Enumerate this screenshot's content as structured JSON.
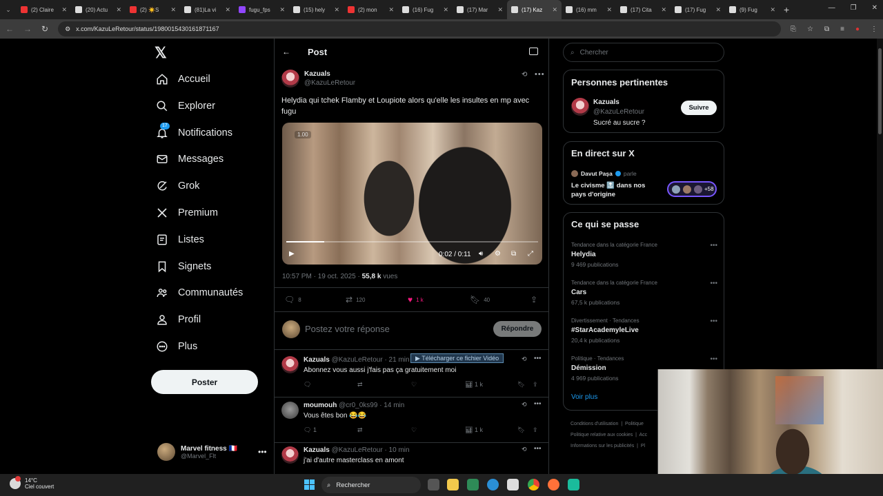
{
  "browser": {
    "tabs": [
      {
        "label": "(2) Claire",
        "color": "#e33"
      },
      {
        "label": "(20) Actu",
        "color": "#ddd"
      },
      {
        "label": "(2) ☀️S",
        "color": "#e33"
      },
      {
        "label": "(81)La vi",
        "color": "#ddd"
      },
      {
        "label": "fugu_fps",
        "color": "#9146ff"
      },
      {
        "label": "(15) hely",
        "color": "#ddd"
      },
      {
        "label": "(2) mon",
        "color": "#e33"
      },
      {
        "label": "(16) Fug",
        "color": "#ddd"
      },
      {
        "label": "(17) Mar",
        "color": "#ddd"
      },
      {
        "label": "(17) Kaz",
        "color": "#ddd"
      },
      {
        "label": "(16) mm",
        "color": "#ddd"
      },
      {
        "label": "(17) Cita",
        "color": "#ddd"
      },
      {
        "label": "(17) Fug",
        "color": "#ddd"
      },
      {
        "label": "(9) Fug",
        "color": "#ddd"
      }
    ],
    "url": "x.com/KazuLeRetour/status/1980015430161871167"
  },
  "sidebar": {
    "items": [
      {
        "label": "Accueil",
        "icon": "home-icon"
      },
      {
        "label": "Explorer",
        "icon": "search-icon"
      },
      {
        "label": "Notifications",
        "icon": "bell-icon",
        "badge": "17"
      },
      {
        "label": "Messages",
        "icon": "envelope-icon"
      },
      {
        "label": "Grok",
        "icon": "grok-icon"
      },
      {
        "label": "Premium",
        "icon": "x-icon"
      },
      {
        "label": "Listes",
        "icon": "list-icon"
      },
      {
        "label": "Signets",
        "icon": "bookmark-icon"
      },
      {
        "label": "Communautés",
        "icon": "people-icon"
      },
      {
        "label": "Profil",
        "icon": "person-icon"
      },
      {
        "label": "Plus",
        "icon": "more-circle-icon"
      }
    ],
    "post_button": "Poster",
    "account": {
      "name": "Marvel fitness 🇫🇷",
      "handle": "@Marvel_Flt"
    }
  },
  "main": {
    "header_title": "Post",
    "post": {
      "author": "Kazuals",
      "handle": "@KazuLeRetour",
      "text": "Helydia qui tchek Flamby et Loupiote alors qu'elle les insultes en mp avec fugu",
      "video": {
        "speed": "1.00",
        "time": "0:02 / 0:11",
        "progress": 0.15
      },
      "timestamp": "10:57 PM · 19 oct. 2025 · ",
      "views_count": "55,8 k",
      "views_label": " vues",
      "replies": "8",
      "reposts": "120",
      "likes": "1 k",
      "bookmarks": "40"
    },
    "reply_placeholder": "Postez votre réponse",
    "reply_button": "Répondre",
    "download_overlay": "▶ Télécharger ce fichier Vidéo",
    "replies": [
      {
        "name": "Kazuals",
        "handle": "@KazuLeRetour",
        "time": "· 21 min",
        "text": "Abonnez vous aussi j'fais pas ça gratuitement moi",
        "views": "1 k",
        "replies": ""
      },
      {
        "name": "moumouh",
        "handle": "@cr0_0ks99",
        "time": "· 14 min",
        "text": "Vous êtes bon 😂😂",
        "views": "1 k",
        "replies": "1"
      },
      {
        "name": "Kazuals",
        "handle": "@KazuLeRetour",
        "time": "· 10 min",
        "text": "j'ai d'autre masterclass en amont",
        "views": "",
        "replies": ""
      }
    ]
  },
  "right": {
    "search_placeholder": "Chercher",
    "relevant": {
      "title": "Personnes pertinentes",
      "name": "Kazuals",
      "handle": "@KazuLeRetour",
      "bio": "Sucré au sucre ?",
      "follow": "Suivre"
    },
    "live": {
      "title": "En direct sur X",
      "host": "Davut Paşa",
      "speaking": "parle",
      "topic": "Le civisme 🔝 dans nos pays d'origine",
      "count": "+58"
    },
    "trending": {
      "title": "Ce qui se passe",
      "items": [
        {
          "category": "Tendance dans la catégorie France",
          "name": "Helydia",
          "count": "9 469 publications"
        },
        {
          "category": "Tendance dans la catégorie France",
          "name": "Cars",
          "count": "67,5 k publications"
        },
        {
          "category": "Divertissement · Tendances",
          "name": "#StarAcademyleLive",
          "count": "20,4 k publications"
        },
        {
          "category": "Politique · Tendances",
          "name": "Démission",
          "count": "4 969 publications"
        }
      ],
      "more": "Voir plus"
    },
    "footer": [
      "Conditions d'utilisation",
      "Politique",
      "Politique relative aux cookies",
      "Acc",
      "Informations sur les publicités",
      "Pl"
    ]
  },
  "taskbar": {
    "temperature": "14°C",
    "weather": "Ciel couvert",
    "search_label": "Rechercher"
  }
}
